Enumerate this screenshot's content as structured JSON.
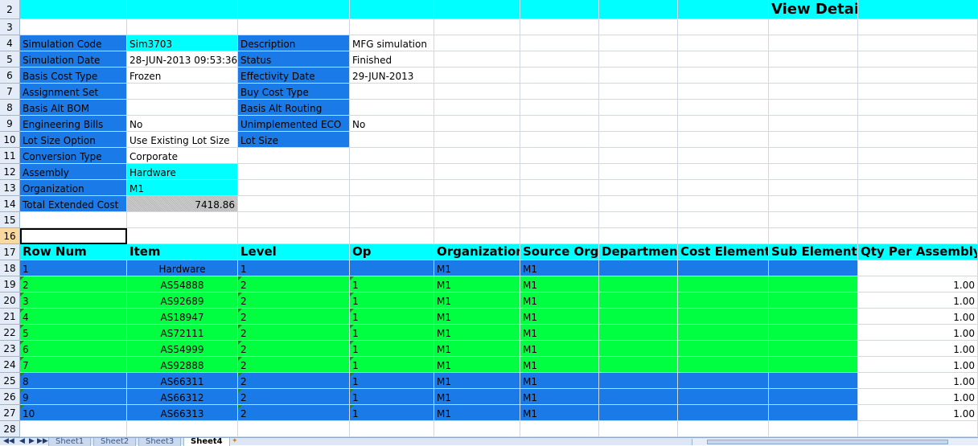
{
  "colors": {
    "blue": "#1a7ae8",
    "cyan": "#00ffff",
    "green": "#00ff40",
    "gray": "#c0c0c0",
    "white": "#ffffff"
  },
  "rows": [
    {
      "num": "2",
      "cells": [
        {
          "t": "",
          "bg": "cyan"
        },
        {
          "t": "",
          "bg": "cyan"
        },
        {
          "t": "",
          "bg": "cyan"
        },
        {
          "t": "",
          "bg": "cyan"
        },
        {
          "t": "",
          "bg": "cyan"
        },
        {
          "t": "",
          "bg": "cyan"
        },
        {
          "t": "",
          "bg": "cyan"
        },
        {
          "t": "",
          "bg": "cyan"
        },
        {
          "t": "View Detail",
          "bg": "cyan",
          "cls": "title"
        },
        {
          "t": "",
          "bg": "cyan"
        }
      ]
    },
    {
      "num": "3",
      "cells": []
    },
    {
      "num": "4",
      "cells": [
        {
          "t": "Simulation Code",
          "bg": "blue"
        },
        {
          "t": "Sim3703",
          "bg": "cyan"
        },
        {
          "t": "Description",
          "bg": "blue"
        },
        {
          "t": "MFG simulation"
        }
      ]
    },
    {
      "num": "5",
      "cells": [
        {
          "t": "Simulation Date",
          "bg": "blue"
        },
        {
          "t": "28-JUN-2013 09:53:36"
        },
        {
          "t": "Status",
          "bg": "blue"
        },
        {
          "t": "Finished"
        }
      ]
    },
    {
      "num": "6",
      "cells": [
        {
          "t": "Basis Cost Type",
          "bg": "blue"
        },
        {
          "t": "Frozen"
        },
        {
          "t": "Effectivity Date",
          "bg": "blue"
        },
        {
          "t": "29-JUN-2013"
        }
      ]
    },
    {
      "num": "7",
      "cells": [
        {
          "t": "Assignment Set",
          "bg": "blue"
        },
        {
          "t": ""
        },
        {
          "t": "Buy Cost Type",
          "bg": "blue"
        },
        {
          "t": ""
        }
      ]
    },
    {
      "num": "8",
      "cells": [
        {
          "t": "Basis Alt BOM",
          "bg": "blue"
        },
        {
          "t": ""
        },
        {
          "t": "Basis Alt Routing",
          "bg": "blue"
        },
        {
          "t": ""
        }
      ]
    },
    {
      "num": "9",
      "cells": [
        {
          "t": "Engineering Bills",
          "bg": "blue"
        },
        {
          "t": "No"
        },
        {
          "t": "Unimplemented ECO",
          "bg": "blue"
        },
        {
          "t": "No"
        }
      ]
    },
    {
      "num": "10",
      "cells": [
        {
          "t": "Lot Size Option",
          "bg": "blue"
        },
        {
          "t": "Use Existing Lot Size"
        },
        {
          "t": "Lot Size",
          "bg": "blue"
        },
        {
          "t": ""
        }
      ]
    },
    {
      "num": "11",
      "cells": [
        {
          "t": "Conversion Type",
          "bg": "blue"
        },
        {
          "t": "Corporate"
        }
      ]
    },
    {
      "num": "12",
      "cells": [
        {
          "t": "Assembly",
          "bg": "blue"
        },
        {
          "t": "Hardware",
          "bg": "cyan"
        }
      ]
    },
    {
      "num": "13",
      "cells": [
        {
          "t": "Organization",
          "bg": "blue"
        },
        {
          "t": "M1",
          "bg": "cyan"
        }
      ]
    },
    {
      "num": "14",
      "cells": [
        {
          "t": "Total Extended Cost",
          "bg": "blue"
        },
        {
          "t": "7418.86",
          "bg": "gray",
          "cls": "right"
        }
      ]
    },
    {
      "num": "15",
      "cells": []
    },
    {
      "num": "16",
      "cells": [],
      "active": true
    },
    {
      "num": "17",
      "cells": [
        {
          "t": "Row Num",
          "bg": "cyan",
          "cls": "bold"
        },
        {
          "t": "Item",
          "bg": "cyan",
          "cls": "bold"
        },
        {
          "t": "Level",
          "bg": "cyan",
          "cls": "bold"
        },
        {
          "t": "Op",
          "bg": "cyan",
          "cls": "bold"
        },
        {
          "t": "Organization",
          "bg": "cyan",
          "cls": "bold"
        },
        {
          "t": "Source Org",
          "bg": "cyan",
          "cls": "bold"
        },
        {
          "t": "Department",
          "bg": "cyan",
          "cls": "bold"
        },
        {
          "t": "Cost Element",
          "bg": "cyan",
          "cls": "bold"
        },
        {
          "t": "Sub Element",
          "bg": "cyan",
          "cls": "bold"
        },
        {
          "t": "Qty Per Assembly",
          "bg": "cyan",
          "cls": "bold"
        }
      ]
    },
    {
      "num": "18",
      "cells": [
        {
          "t": "1",
          "bg": "blue"
        },
        {
          "t": "Hardware",
          "bg": "blue",
          "cls": "center"
        },
        {
          "t": "1",
          "bg": "blue"
        },
        {
          "t": "",
          "bg": "blue"
        },
        {
          "t": "M1",
          "bg": "blue"
        },
        {
          "t": "M1",
          "bg": "blue"
        },
        {
          "t": "",
          "bg": "blue"
        },
        {
          "t": "",
          "bg": "blue"
        },
        {
          "t": "",
          "bg": "blue"
        },
        {
          "t": ""
        }
      ]
    },
    {
      "num": "19",
      "cells": [
        {
          "t": "2",
          "bg": "green",
          "tri": true
        },
        {
          "t": "AS54888",
          "bg": "green",
          "cls": "center"
        },
        {
          "t": "2",
          "bg": "green",
          "tri": true
        },
        {
          "t": "1",
          "bg": "green",
          "tri": true
        },
        {
          "t": "M1",
          "bg": "green"
        },
        {
          "t": "M1",
          "bg": "green"
        },
        {
          "t": "",
          "bg": "green"
        },
        {
          "t": "",
          "bg": "green"
        },
        {
          "t": "",
          "bg": "green"
        },
        {
          "t": "1.00",
          "cls": "right"
        }
      ]
    },
    {
      "num": "20",
      "cells": [
        {
          "t": "3",
          "bg": "green",
          "tri": true
        },
        {
          "t": "AS92689",
          "bg": "green",
          "cls": "center"
        },
        {
          "t": "2",
          "bg": "green",
          "tri": true
        },
        {
          "t": "1",
          "bg": "green",
          "tri": true
        },
        {
          "t": "M1",
          "bg": "green"
        },
        {
          "t": "M1",
          "bg": "green"
        },
        {
          "t": "",
          "bg": "green"
        },
        {
          "t": "",
          "bg": "green"
        },
        {
          "t": "",
          "bg": "green"
        },
        {
          "t": "1.00",
          "cls": "right"
        }
      ]
    },
    {
      "num": "21",
      "cells": [
        {
          "t": "4",
          "bg": "green",
          "tri": true
        },
        {
          "t": "AS18947",
          "bg": "green",
          "cls": "center"
        },
        {
          "t": "2",
          "bg": "green",
          "tri": true
        },
        {
          "t": "1",
          "bg": "green",
          "tri": true
        },
        {
          "t": "M1",
          "bg": "green"
        },
        {
          "t": "M1",
          "bg": "green"
        },
        {
          "t": "",
          "bg": "green"
        },
        {
          "t": "",
          "bg": "green"
        },
        {
          "t": "",
          "bg": "green"
        },
        {
          "t": "1.00",
          "cls": "right"
        }
      ]
    },
    {
      "num": "22",
      "cells": [
        {
          "t": "5",
          "bg": "green",
          "tri": true
        },
        {
          "t": "AS72111",
          "bg": "green",
          "cls": "center"
        },
        {
          "t": "2",
          "bg": "green",
          "tri": true
        },
        {
          "t": "1",
          "bg": "green",
          "tri": true
        },
        {
          "t": "M1",
          "bg": "green"
        },
        {
          "t": "M1",
          "bg": "green"
        },
        {
          "t": "",
          "bg": "green"
        },
        {
          "t": "",
          "bg": "green"
        },
        {
          "t": "",
          "bg": "green"
        },
        {
          "t": "1.00",
          "cls": "right"
        }
      ]
    },
    {
      "num": "23",
      "cells": [
        {
          "t": "6",
          "bg": "green",
          "tri": true
        },
        {
          "t": "AS54999",
          "bg": "green",
          "cls": "center"
        },
        {
          "t": "2",
          "bg": "green",
          "tri": true
        },
        {
          "t": "1",
          "bg": "green",
          "tri": true
        },
        {
          "t": "M1",
          "bg": "green"
        },
        {
          "t": "M1",
          "bg": "green"
        },
        {
          "t": "",
          "bg": "green"
        },
        {
          "t": "",
          "bg": "green"
        },
        {
          "t": "",
          "bg": "green"
        },
        {
          "t": "1.00",
          "cls": "right"
        }
      ]
    },
    {
      "num": "24",
      "cells": [
        {
          "t": "7",
          "bg": "green",
          "tri": true
        },
        {
          "t": "AS92888",
          "bg": "green",
          "cls": "center"
        },
        {
          "t": "2",
          "bg": "green",
          "tri": true
        },
        {
          "t": "1",
          "bg": "green",
          "tri": true
        },
        {
          "t": "M1",
          "bg": "green"
        },
        {
          "t": "M1",
          "bg": "green"
        },
        {
          "t": "",
          "bg": "green"
        },
        {
          "t": "",
          "bg": "green"
        },
        {
          "t": "",
          "bg": "green"
        },
        {
          "t": "1.00",
          "cls": "right"
        }
      ]
    },
    {
      "num": "25",
      "cells": [
        {
          "t": "8",
          "bg": "blue",
          "tri": true
        },
        {
          "t": "AS66311",
          "bg": "blue",
          "cls": "center"
        },
        {
          "t": "2",
          "bg": "blue",
          "tri": true
        },
        {
          "t": "1",
          "bg": "blue",
          "tri": true
        },
        {
          "t": "M1",
          "bg": "blue"
        },
        {
          "t": "M1",
          "bg": "blue"
        },
        {
          "t": "",
          "bg": "blue"
        },
        {
          "t": "",
          "bg": "blue"
        },
        {
          "t": "",
          "bg": "blue"
        },
        {
          "t": "1.00",
          "cls": "right"
        }
      ]
    },
    {
      "num": "26",
      "cells": [
        {
          "t": "9",
          "bg": "blue",
          "tri": true
        },
        {
          "t": "AS66312",
          "bg": "blue",
          "cls": "center"
        },
        {
          "t": "2",
          "bg": "blue",
          "tri": true
        },
        {
          "t": "1",
          "bg": "blue",
          "tri": true
        },
        {
          "t": "M1",
          "bg": "blue"
        },
        {
          "t": "M1",
          "bg": "blue"
        },
        {
          "t": "",
          "bg": "blue"
        },
        {
          "t": "",
          "bg": "blue"
        },
        {
          "t": "",
          "bg": "blue"
        },
        {
          "t": "1.00",
          "cls": "right"
        }
      ]
    },
    {
      "num": "27",
      "cells": [
        {
          "t": "10",
          "bg": "blue",
          "tri": true
        },
        {
          "t": "AS66313",
          "bg": "blue",
          "cls": "center"
        },
        {
          "t": "2",
          "bg": "blue",
          "tri": true
        },
        {
          "t": "1",
          "bg": "blue",
          "tri": true
        },
        {
          "t": "M1",
          "bg": "blue"
        },
        {
          "t": "M1",
          "bg": "blue"
        },
        {
          "t": "",
          "bg": "blue"
        },
        {
          "t": "",
          "bg": "blue"
        },
        {
          "t": "",
          "bg": "blue"
        },
        {
          "t": "1.00",
          "cls": "right"
        }
      ]
    },
    {
      "num": "28",
      "cells": []
    }
  ],
  "sheet_tabs": [
    "Sheet1",
    "Sheet2",
    "Sheet3",
    "Sheet4"
  ],
  "active_tab": "Sheet4"
}
